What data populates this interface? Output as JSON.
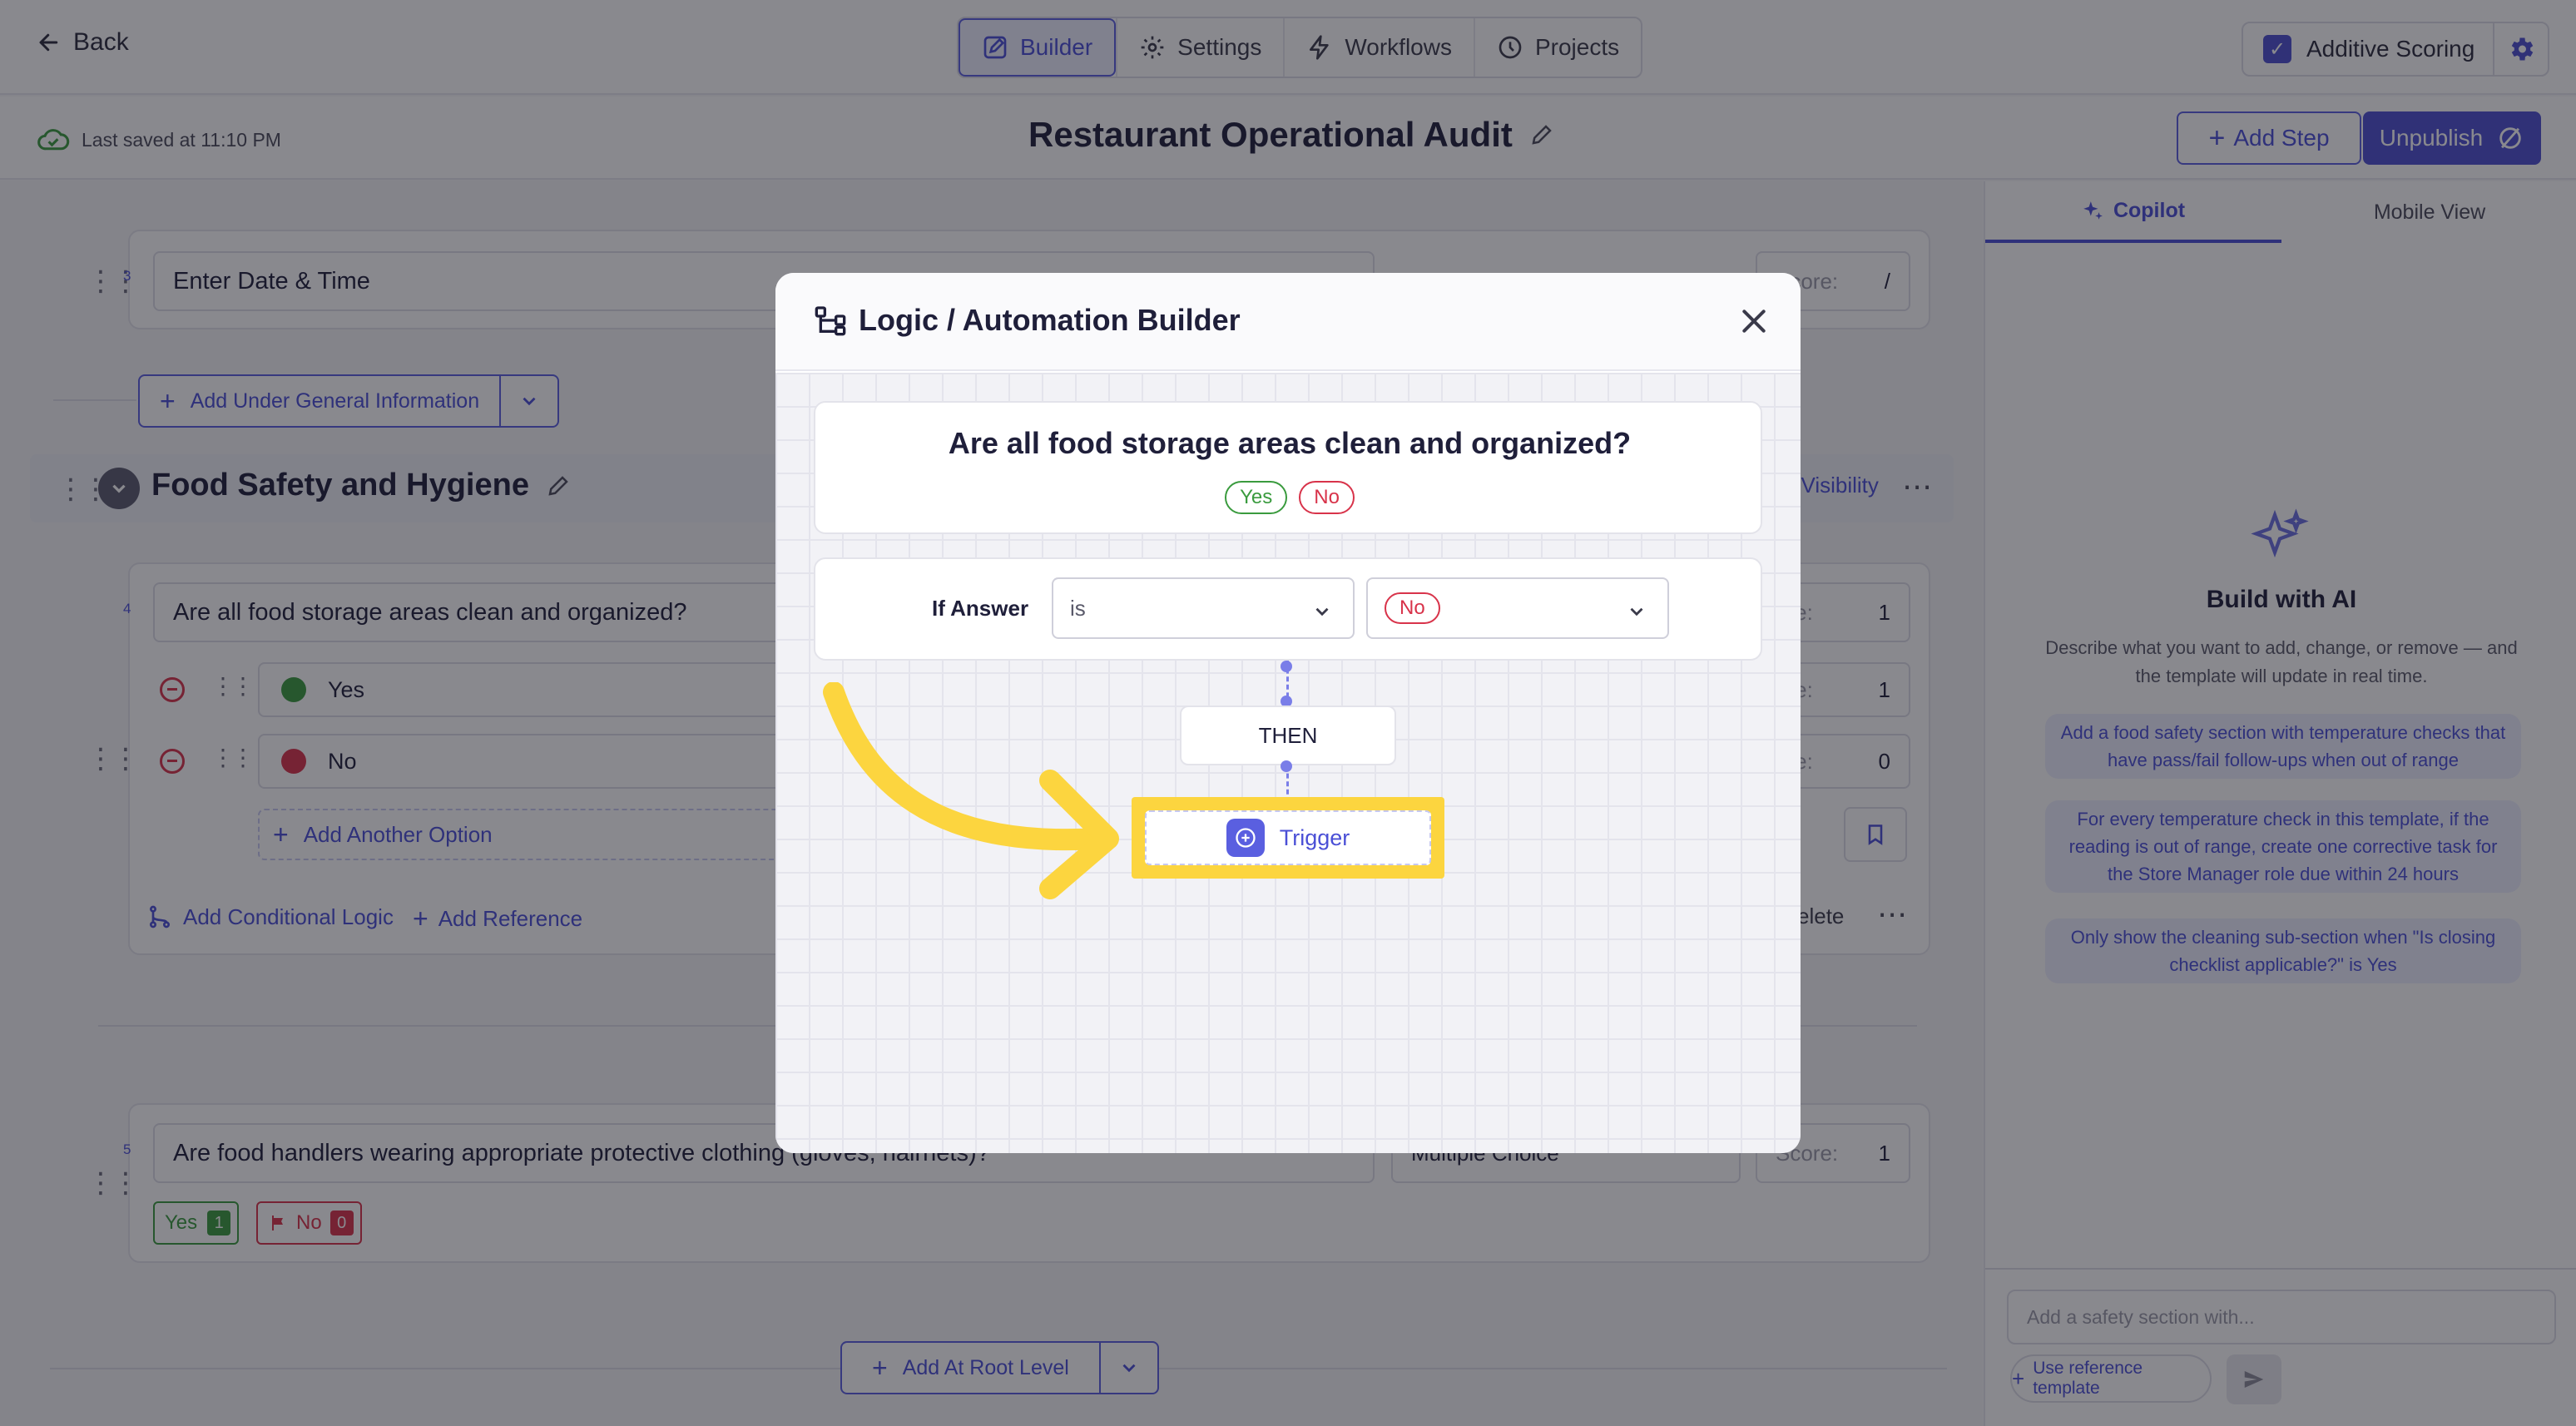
{
  "topbar": {
    "back_label": "Back",
    "tabs": [
      {
        "label": "Builder",
        "icon": "edit-icon",
        "active": true
      },
      {
        "label": "Settings",
        "icon": "gear-icon",
        "active": false
      },
      {
        "label": "Workflows",
        "icon": "bolt-icon",
        "active": false
      },
      {
        "label": "Projects",
        "icon": "clock-icon",
        "active": false
      }
    ],
    "additive_scoring_label": "Additive Scoring",
    "additive_scoring_checked": true
  },
  "subbar": {
    "saved_text": "Last saved at 11:10 PM",
    "title": "Restaurant Operational Audit",
    "add_step_label": "Add Step",
    "unpublish_label": "Unpublish"
  },
  "builder": {
    "q3": {
      "number": "3",
      "text": "Enter Date & Time",
      "score_label": "Score:",
      "score_value": "/"
    },
    "add_under_label": "Add Under General Information",
    "section": {
      "title": "Food Safety and Hygiene",
      "visibility_label": "t Visibility"
    },
    "q4": {
      "number": "4",
      "text": "Are all food storage areas clean and organized?",
      "score_label": "ore:",
      "score_value": "1",
      "options": [
        {
          "label": "Yes",
          "color": "#3a9b3e",
          "score_label": "ore:",
          "score": "1"
        },
        {
          "label": "No",
          "color": "#d8334a",
          "score_label": "ore:",
          "score": "0"
        }
      ],
      "add_option_label": "Add Another Option",
      "add_logic_label": "Add Conditional Logic",
      "add_reference_label": "Add Reference",
      "delete_label": "elete"
    },
    "q5": {
      "number": "5",
      "text": "Are food handlers wearing appropriate protective clothing (gloves, hairnets)?",
      "type_label": "Multiple Choice",
      "score_label": "Score:",
      "score_value": "1",
      "tags": [
        {
          "label": "Yes",
          "value": "1",
          "color": "#3a9b3e"
        },
        {
          "label": "No",
          "value": "0",
          "color": "#d8334a"
        }
      ]
    },
    "add_root_label": "Add At Root Level"
  },
  "panel": {
    "tabs": [
      {
        "label": "Copilot",
        "active": true
      },
      {
        "label": "Mobile View",
        "active": false
      }
    ],
    "ai_title": "Build with AI",
    "ai_desc": "Describe what you want to add, change, or remove — and the template will update in real time.",
    "suggestions": [
      "Add a food safety section with temperature checks that have pass/fail follow-ups when out of range",
      "For every temperature check in this template, if the reading is out of range, create one corrective task for the Store Manager role due within 24 hours",
      "Only show the cleaning sub-section when \"Is closing checklist applicable?\" is Yes"
    ],
    "chat_placeholder": "Add a safety section with...",
    "use_reference_label": "Use reference template"
  },
  "modal": {
    "title": "Logic / Automation Builder",
    "question": "Are all food storage areas clean and organized?",
    "options": [
      "Yes",
      "No"
    ],
    "if_answer_label": "If Answer",
    "operator_value": "is",
    "answer_value": "No",
    "then_label": "THEN",
    "trigger_label": "Trigger"
  },
  "colors": {
    "accent": "#4c4fd0",
    "highlight": "#fcd53f",
    "yes": "#3a9b3e",
    "no": "#d8334a"
  }
}
